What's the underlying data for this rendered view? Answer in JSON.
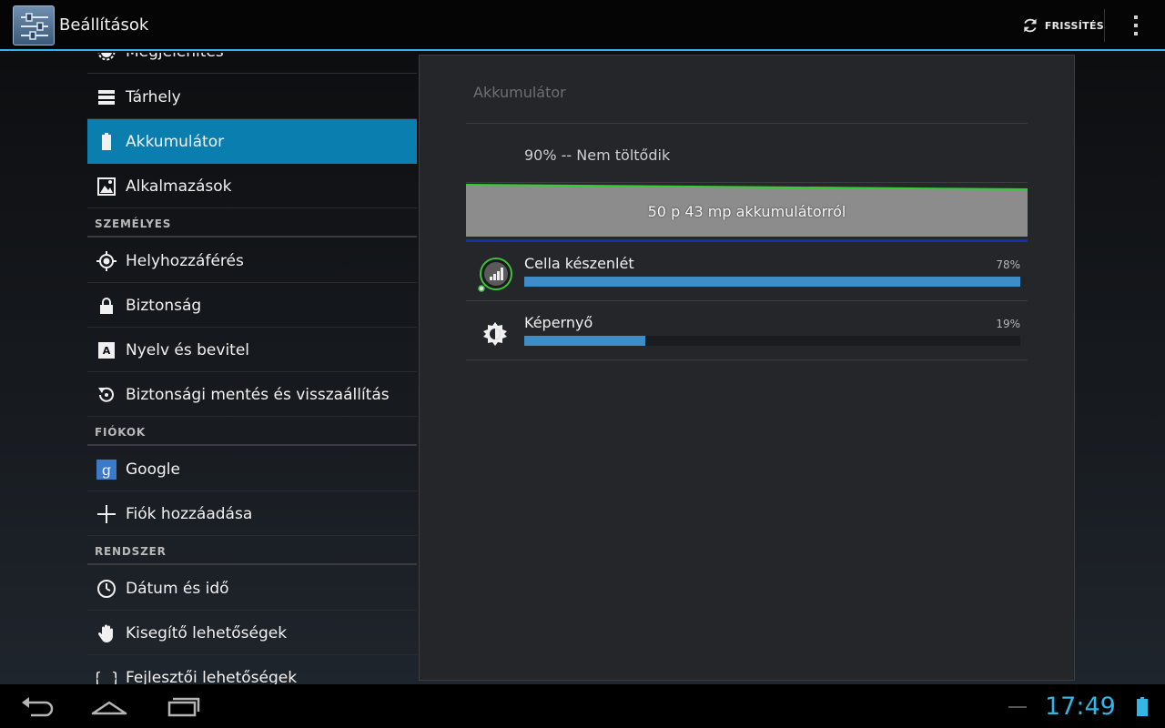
{
  "actionbar": {
    "title": "Beállítások",
    "refresh_label": "FRISSÍTÉS"
  },
  "list": {
    "rows": [
      {
        "label": "Megjelenítés",
        "icon": "display-icon"
      },
      {
        "label": "Tárhely",
        "icon": "storage-icon"
      },
      {
        "label": "Akkumulátor",
        "icon": "battery-icon",
        "active": true
      },
      {
        "label": "Alkalmazások",
        "icon": "apps-icon"
      }
    ],
    "sections": {
      "personal": "SZEMÉLYES",
      "accounts": "FIÓKOK",
      "system": "RENDSZER"
    },
    "personal_rows": [
      {
        "label": "Helyhozzáférés",
        "icon": "location-icon"
      },
      {
        "label": "Biztonság",
        "icon": "lock-icon"
      },
      {
        "label": "Nyelv és bevitel",
        "icon": "language-icon"
      },
      {
        "label": "Biztonsági mentés és visszaállítás",
        "icon": "backup-icon"
      }
    ],
    "account_rows": [
      {
        "label": "Google",
        "icon": "google-icon"
      },
      {
        "label": "Fiók hozzáadása",
        "icon": "plus-icon"
      }
    ],
    "system_rows": [
      {
        "label": "Dátum és idő",
        "icon": "clock-icon"
      },
      {
        "label": "Kisegítő lehetőségek",
        "icon": "hand-icon"
      },
      {
        "label": "Fejlesztői lehetőségek",
        "icon": "braces-icon"
      }
    ]
  },
  "detail": {
    "title": "Akkumulátor",
    "status": "90% -- Nem töltődik",
    "graph_label": "50 p 43 mp akkumulátorról",
    "usage": [
      {
        "name": "Cella készenlét",
        "percent_label": "78%",
        "value": 78,
        "icon": "cell-standby-icon"
      },
      {
        "name": "Képernyő",
        "percent_label": "19%",
        "value": 19,
        "icon": "screen-brightness-icon"
      }
    ]
  },
  "statusbar": {
    "time": "17:49"
  },
  "colors": {
    "accent": "#33b5e5",
    "active_row": "#0b7eb0",
    "usage_bar": "#3f8dc6"
  }
}
